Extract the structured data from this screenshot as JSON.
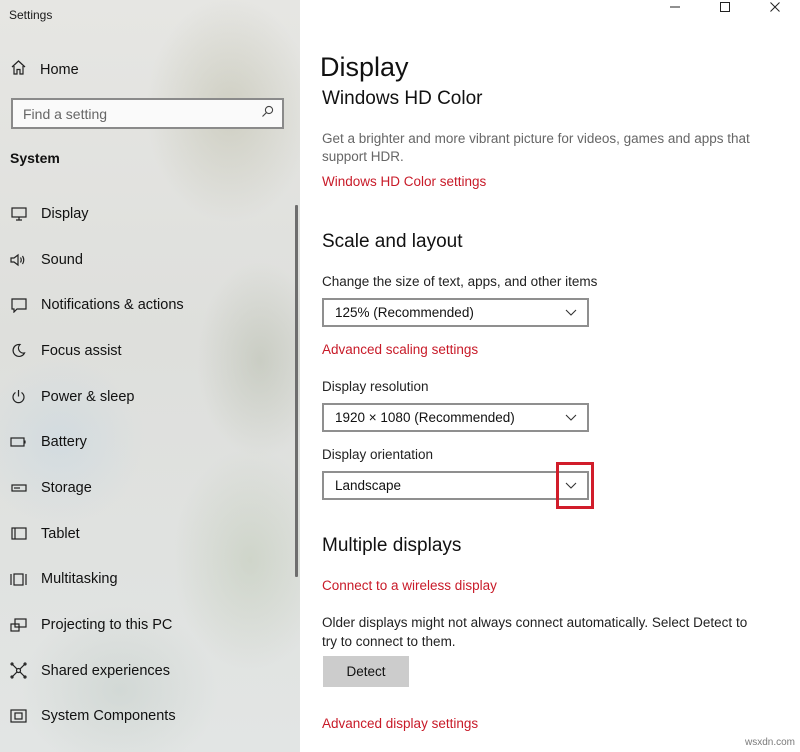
{
  "window": {
    "title": "Settings",
    "controls": {
      "minimize": "minimize-icon",
      "maximize": "maximize-icon",
      "close": "close-icon"
    }
  },
  "sidebar": {
    "home_label": "Home",
    "search": {
      "placeholder": "Find a setting"
    },
    "section_label": "System",
    "items": [
      {
        "label": "Display",
        "icon": "monitor-icon"
      },
      {
        "label": "Sound",
        "icon": "speaker-icon"
      },
      {
        "label": "Notifications & actions",
        "icon": "notification-icon"
      },
      {
        "label": "Focus assist",
        "icon": "moon-icon"
      },
      {
        "label": "Power & sleep",
        "icon": "power-icon"
      },
      {
        "label": "Battery",
        "icon": "battery-icon"
      },
      {
        "label": "Storage",
        "icon": "storage-icon"
      },
      {
        "label": "Tablet",
        "icon": "tablet-icon"
      },
      {
        "label": "Multitasking",
        "icon": "multitasking-icon"
      },
      {
        "label": "Projecting to this PC",
        "icon": "projecting-icon"
      },
      {
        "label": "Shared experiences",
        "icon": "shared-experiences-icon"
      },
      {
        "label": "System Components",
        "icon": "system-components-icon"
      }
    ]
  },
  "main": {
    "page_title": "Display",
    "hd_color": {
      "heading": "Windows HD Color",
      "description": "Get a brighter and more vibrant picture for videos, games and apps that support HDR.",
      "link": "Windows HD Color settings"
    },
    "scale_layout": {
      "heading": "Scale and layout",
      "scale_label": "Change the size of text, apps, and other items",
      "scale_value": "125% (Recommended)",
      "advanced_scaling_link": "Advanced scaling settings",
      "resolution_label": "Display resolution",
      "resolution_value": "1920 × 1080 (Recommended)",
      "orientation_label": "Display orientation",
      "orientation_value": "Landscape"
    },
    "multiple_displays": {
      "heading": "Multiple displays",
      "wireless_link": "Connect to a wireless display",
      "description": "Older displays might not always connect automatically. Select Detect to try to connect to them.",
      "detect_button": "Detect",
      "advanced_display_link": "Advanced display settings"
    }
  },
  "watermark": "wsxdn.com",
  "colors": {
    "link": "#c81a28",
    "highlight_box": "#d11d2a",
    "detect_button_bg": "#cccccc"
  }
}
